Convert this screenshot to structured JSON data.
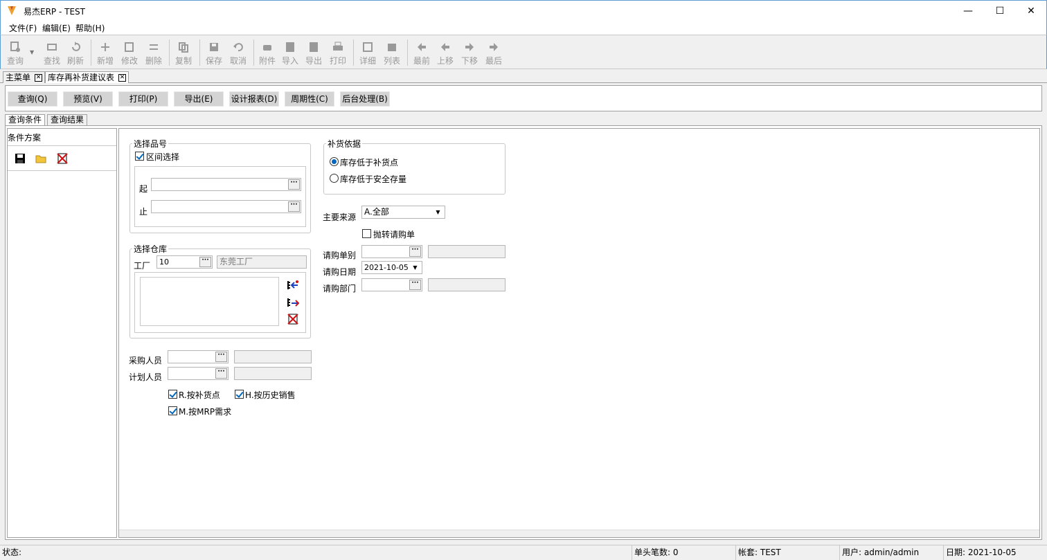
{
  "window": {
    "title": "易杰ERP - TEST",
    "minimize": "—",
    "maximize": "☐",
    "close": "✕"
  },
  "menu": [
    {
      "label": "文件(F)"
    },
    {
      "label": "编辑(E)"
    },
    {
      "label": "帮助(H)"
    }
  ],
  "toolbar": [
    {
      "label": "查询",
      "icon": "query-icon"
    },
    {
      "label": "查找",
      "icon": "find-icon"
    },
    {
      "label": "刷新",
      "icon": "refresh-icon"
    },
    {
      "label": "新增",
      "icon": "add-icon"
    },
    {
      "label": "修改",
      "icon": "edit-icon"
    },
    {
      "label": "删除",
      "icon": "delete-icon"
    },
    {
      "label": "复制",
      "icon": "copy-icon"
    },
    {
      "label": "保存",
      "icon": "save-icon"
    },
    {
      "label": "取消",
      "icon": "undo-icon"
    },
    {
      "label": "附件",
      "icon": "attachment-icon"
    },
    {
      "label": "导入",
      "icon": "import-icon"
    },
    {
      "label": "导出",
      "icon": "export-icon"
    },
    {
      "label": "打印",
      "icon": "print-icon"
    },
    {
      "label": "详细",
      "icon": "detail-icon"
    },
    {
      "label": "列表",
      "icon": "list-icon"
    },
    {
      "label": "最前",
      "icon": "first-icon"
    },
    {
      "label": "上移",
      "icon": "up-icon"
    },
    {
      "label": "下移",
      "icon": "down-icon"
    },
    {
      "label": "最后",
      "icon": "last-icon"
    }
  ],
  "tabs": [
    {
      "label": "主菜单"
    },
    {
      "label": "库存再补货建议表"
    }
  ],
  "actions": [
    {
      "label": "查询(Q)"
    },
    {
      "label": "预览(V)"
    },
    {
      "label": "打印(P)"
    },
    {
      "label": "导出(E)"
    },
    {
      "label": "设计报表(D)"
    },
    {
      "label": "周期性(C)"
    },
    {
      "label": "后台处理(B)"
    }
  ],
  "subtabs": [
    {
      "label": "查询条件"
    },
    {
      "label": "查询结果"
    }
  ],
  "left_panel": {
    "title": "条件方案"
  },
  "form": {
    "item_group": {
      "title": "选择品号",
      "range_label": "区间选择",
      "range_checked": true,
      "from_label": "起",
      "from_value": "",
      "to_label": "止",
      "to_value": ""
    },
    "warehouse_group": {
      "title": "选择仓库",
      "factory_label": "工厂",
      "factory_value": "10",
      "factory_name": "东莞工厂"
    },
    "buyer_label": "采购人员",
    "buyer_value": "",
    "planner_label": "计划人员",
    "planner_value": "",
    "opt_reorder": "R.按补货点",
    "opt_history": "H.按历史销售",
    "opt_mrp": "M.按MRP需求",
    "basis_group": {
      "title": "补货依据",
      "opt1": "库存低于补货点",
      "opt2": "库存低于安全存量"
    },
    "source_label": "主要来源",
    "source_value": "A.全部",
    "throw_pr": "抛转请购单",
    "pr_type_label": "请购单别",
    "pr_type_value": "",
    "pr_date_label": "请购日期",
    "pr_date_value": "2021-10-05",
    "pr_dept_label": "请购部门",
    "pr_dept_value": ""
  },
  "status": {
    "state": "状态:",
    "head_count": "单头笔数: 0",
    "account": "帐套: TEST",
    "user": "用户: admin/admin",
    "date": "日期: 2021-10-05"
  },
  "colors": {
    "accent": "#0067c0",
    "window_border": "#5a9bd5",
    "toolbar_disabled": "#9a9a9a"
  }
}
